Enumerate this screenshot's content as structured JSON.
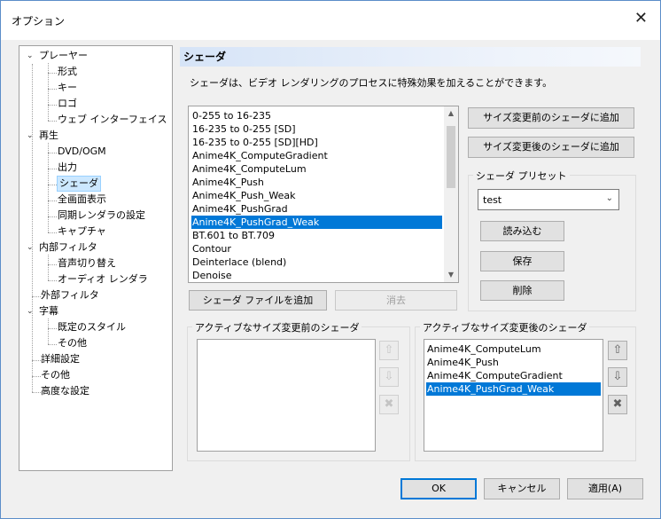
{
  "window": {
    "title": "オプション",
    "close_glyph": "✕"
  },
  "tree": {
    "items": [
      {
        "label": "プレーヤー",
        "level": 0,
        "toggle": "⌄"
      },
      {
        "label": "形式",
        "level": 1
      },
      {
        "label": "キー",
        "level": 1
      },
      {
        "label": "ロゴ",
        "level": 1
      },
      {
        "label": "ウェブ インターフェイス",
        "level": 1
      },
      {
        "label": "再生",
        "level": 0,
        "toggle": "⌄"
      },
      {
        "label": "DVD/OGM",
        "level": 1
      },
      {
        "label": "出力",
        "level": 1
      },
      {
        "label": "シェーダ",
        "level": 1,
        "selected": true
      },
      {
        "label": "全画面表示",
        "level": 1
      },
      {
        "label": "同期レンダラの設定",
        "level": 1
      },
      {
        "label": "キャプチャ",
        "level": 1
      },
      {
        "label": "内部フィルタ",
        "level": 0,
        "toggle": "⌄"
      },
      {
        "label": "音声切り替え",
        "level": 1
      },
      {
        "label": "オーディオ レンダラ",
        "level": 1
      },
      {
        "label": "外部フィルタ",
        "level": 0
      },
      {
        "label": "字幕",
        "level": 0,
        "toggle": "⌄"
      },
      {
        "label": "既定のスタイル",
        "level": 1
      },
      {
        "label": "その他",
        "level": 1
      },
      {
        "label": "詳細設定",
        "level": 0
      },
      {
        "label": "その他",
        "level": 0
      },
      {
        "label": "高度な設定",
        "level": 0
      }
    ]
  },
  "shader_page": {
    "header": "シェーダ",
    "description": "シェーダは、ビデオ レンダリングのプロセスに特殊効果を加えることができます。",
    "shader_list": [
      "0-255 to 16-235",
      "16-235 to 0-255 [SD]",
      "16-235 to 0-255 [SD][HD]",
      "Anime4K_ComputeGradient",
      "Anime4K_ComputeLum",
      "Anime4K_Push",
      "Anime4K_Push_Weak",
      "Anime4K_PushGrad",
      "Anime4K_PushGrad_Weak",
      "BT.601 to BT.709",
      "Contour",
      "Deinterlace (blend)",
      "Denoise"
    ],
    "shader_list_selected_index": 8,
    "add_pre_resize_button": "サイズ変更前のシェーダに追加",
    "add_post_resize_button": "サイズ変更後のシェーダに追加",
    "add_shader_file_button": "シェーダ ファイルを追加",
    "remove_button": "消去",
    "preset_group_label": "シェーダ プリセット",
    "preset_value": "test",
    "load_button": "読み込む",
    "save_button": "保存",
    "delete_button": "削除",
    "pre_group_label": "アクティブなサイズ変更前のシェーダ",
    "pre_list": [],
    "post_group_label": "アクティブなサイズ変更後のシェーダ",
    "post_list": [
      "Anime4K_ComputeLum",
      "Anime4K_Push",
      "Anime4K_ComputeGradient",
      "Anime4K_PushGrad_Weak"
    ],
    "post_list_selected_index": 3
  },
  "footer": {
    "ok": "OK",
    "cancel": "キャンセル",
    "apply": "適用(A)"
  },
  "colors": {
    "selection": "#0078d7",
    "accent_border": "#0078d7"
  }
}
